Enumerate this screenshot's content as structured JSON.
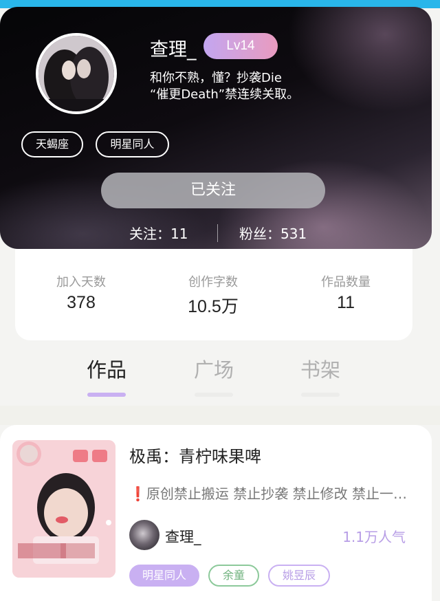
{
  "profile": {
    "username": "查理_",
    "level": "Lv14",
    "bio_line1": "和你不熟，懂？抄袭Die",
    "bio_line2": "“催更Death”禁连续关取。",
    "tags": [
      "天蝎座",
      "明星同人"
    ],
    "follow_button": "已关注",
    "following": "关注：11",
    "followers": "粉丝：531"
  },
  "stats": [
    {
      "label": "加入天数",
      "value": "378"
    },
    {
      "label": "创作字数",
      "value": "10.5万"
    },
    {
      "label": "作品数量",
      "value": "11"
    }
  ],
  "tabs": [
    {
      "label": "作品",
      "active": true
    },
    {
      "label": "广场",
      "active": false
    },
    {
      "label": "书架",
      "active": false
    }
  ],
  "book": {
    "title": "极禹：青柠味果啤",
    "description": "❗原创禁止搬运 禁止抄袭 禁止修改 禁止一…",
    "author": "查理_",
    "popularity": "1.1万人气",
    "tags": [
      {
        "label": "明星同人",
        "style": "filled"
      },
      {
        "label": "余童",
        "style": "green"
      },
      {
        "label": "姚昱辰",
        "style": "purple"
      }
    ]
  },
  "colors": {
    "accent_purple": "#c9b0f2",
    "level_gradient_start": "#c3a6f0",
    "level_gradient_end": "#e99bbf",
    "topbar_blue": "#29b6ea",
    "tag_green": "#8cc99a",
    "popularity": "#b79de6"
  }
}
